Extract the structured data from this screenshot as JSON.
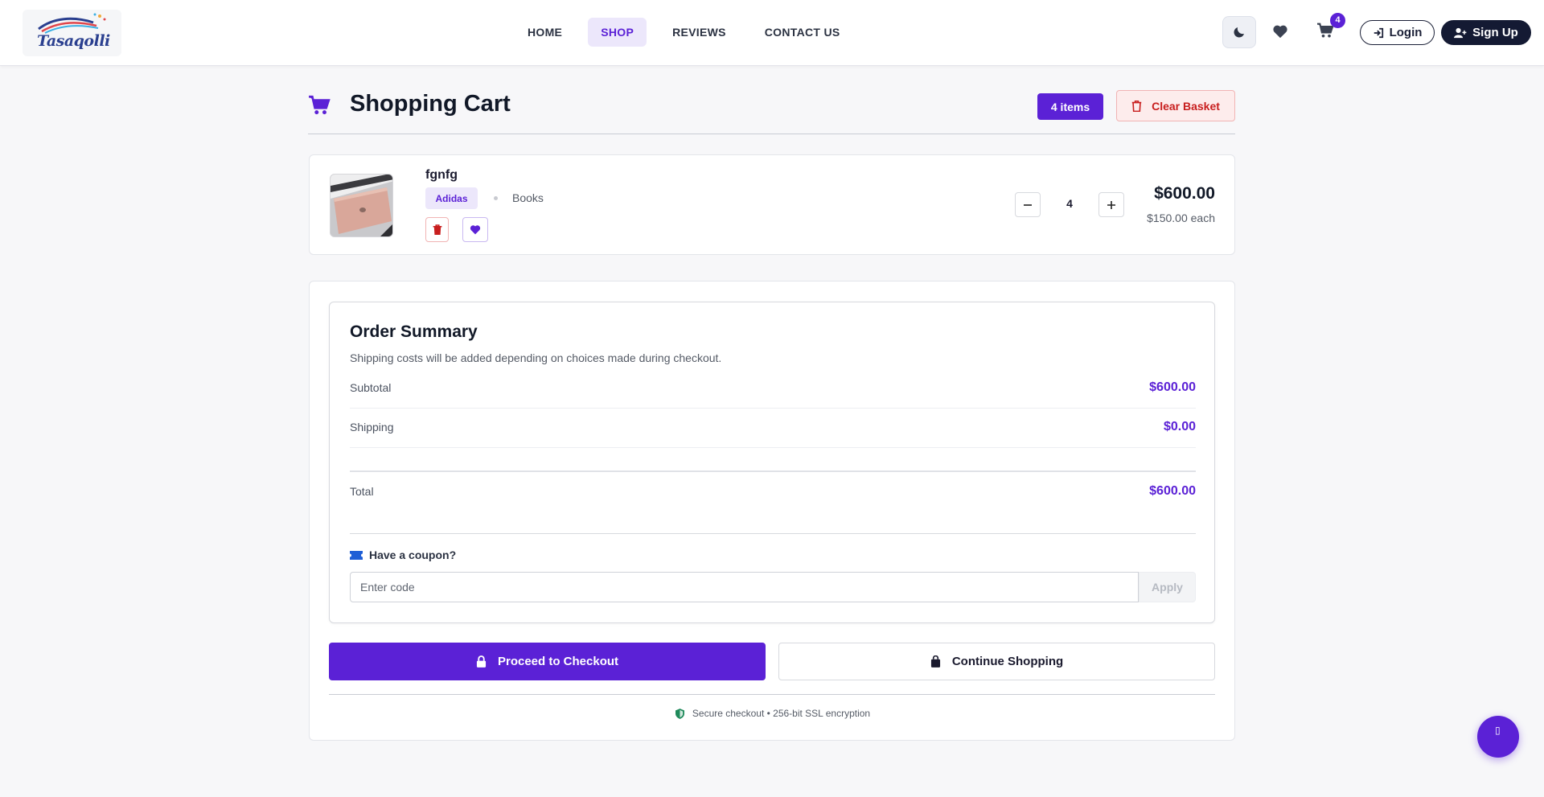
{
  "brand": {
    "name": "Tasaqolli"
  },
  "nav": {
    "home": "HOME",
    "shop": "SHOP",
    "reviews": "REVIEWS",
    "contact": "CONTACT US"
  },
  "header": {
    "cart_count": "4",
    "login_label": "Login",
    "signup_label": "Sign Up"
  },
  "cart": {
    "title": "Shopping Cart",
    "items_count_label": "4 items",
    "clear_label": "Clear Basket",
    "items": [
      {
        "name": "fgnfg",
        "brand": "Adidas",
        "category": "Books",
        "quantity": "4",
        "total_price": "$600.00",
        "unit_price": "$150.00 each"
      }
    ]
  },
  "summary": {
    "title": "Order Summary",
    "note": "Shipping costs will be added depending on choices made during checkout.",
    "subtotal_label": "Subtotal",
    "subtotal_value": "$600.00",
    "shipping_label": "Shipping",
    "shipping_value": "$0.00",
    "total_label": "Total",
    "total_value": "$600.00",
    "coupon_label": "Have a coupon?",
    "coupon_placeholder": "Enter code",
    "apply_label": "Apply"
  },
  "actions": {
    "checkout_label": "Proceed to Checkout",
    "continue_label": "Continue Shopping",
    "secure_text": "Secure checkout • 256-bit SSL encryption"
  },
  "fab": {
    "icon": "▯"
  },
  "colors": {
    "accent": "#5b21d6",
    "danger": "#c81e1e",
    "dark": "#141a33"
  },
  "icons": [
    "moon-icon",
    "heart-icon",
    "cart-icon",
    "login-icon",
    "user-plus-icon",
    "trash-icon",
    "ticket-icon",
    "lock-icon",
    "bag-icon",
    "shield-icon"
  ]
}
